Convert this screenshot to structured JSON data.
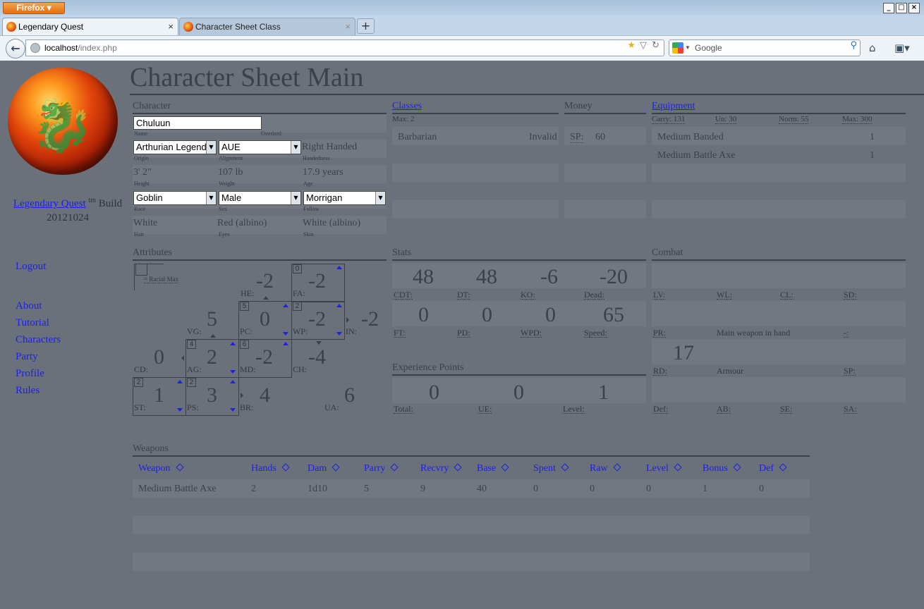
{
  "browser": {
    "menu_button": "Firefox ▾",
    "tabs": [
      {
        "title": "Legendary Quest",
        "close": "×"
      },
      {
        "title": "Character Sheet Class",
        "close": "×"
      }
    ],
    "new_tab": "+",
    "url_host": "localhost",
    "url_path": "/index.php",
    "search_placeholder": "Google",
    "window_min": "_",
    "window_max": "□",
    "window_close": "×"
  },
  "sidebar": {
    "brand_link": "Legendary Quest",
    "brand_sup": "tm",
    "build_label": "Build",
    "build_number": "20121024",
    "logout": "Logout",
    "nav": [
      "About",
      "Tutorial",
      "Characters",
      "Party",
      "Profile",
      "Rules"
    ]
  },
  "page": {
    "title": "Character Sheet Main"
  },
  "character": {
    "section": "Character",
    "name_value": "Chuluun",
    "name_label": "Name",
    "overlord_label": "Overlord",
    "origin_value": "Arthurian Legend",
    "origin_label": "Origin",
    "alignment_value": "AUE",
    "alignment_label": "Alignment",
    "handedness_value": "Right Handed",
    "handedness_label": "Handedness",
    "height_value": "3' 2\"",
    "height_label": "Height",
    "weight_value": "107 lb",
    "weight_label": "Weight",
    "age_value": "17.9 years",
    "age_label": "Age",
    "race_value": "Goblin",
    "race_label": "Race",
    "sex_value": "Male",
    "sex_label": "Sex",
    "follow_value": "Morrigan",
    "follow_label": "Follow",
    "hair_value": "White",
    "hair_label": "Hair",
    "eyes_value": "Red (albino)",
    "eyes_label": "Eyes",
    "skin_value": "White (albino)",
    "skin_label": "Skin"
  },
  "classes": {
    "section": "Classes",
    "max": "Max: 2",
    "items": [
      {
        "name": "Barbarian",
        "status": "Invalid"
      }
    ]
  },
  "money": {
    "section": "Money",
    "sp_label": "SP:",
    "sp_value": "60"
  },
  "equipment": {
    "section": "Equipment",
    "carry": "Carry: 131",
    "un": "Un: 30",
    "norm": "Norm: 55",
    "max": "Max: 300",
    "items": [
      {
        "name": "Medium Banded",
        "qty": "1"
      },
      {
        "name": "Medium Battle Axe",
        "qty": "1"
      }
    ]
  },
  "attributes": {
    "section": "Attributes",
    "racial_max": "= Racial Max",
    "he": {
      "label": "HE:",
      "value": "-2"
    },
    "fa": {
      "label": "FA:",
      "value": "-2",
      "box": "0"
    },
    "vg": {
      "label": "VG:",
      "value": "5"
    },
    "pc": {
      "label": "PC:",
      "value": "0",
      "box": "5"
    },
    "wp": {
      "label": "WP:",
      "value": "-2",
      "box": "2"
    },
    "in": {
      "label": "IN:",
      "value": "-2"
    },
    "cd": {
      "label": "CD:",
      "value": "0"
    },
    "ag": {
      "label": "AG:",
      "value": "2",
      "box": "4"
    },
    "md": {
      "label": "MD:",
      "value": "-2",
      "box": "6"
    },
    "ch": {
      "label": "CH:",
      "value": "-4"
    },
    "st": {
      "label": "ST:",
      "value": "1",
      "box": "2"
    },
    "ps": {
      "label": "PS:",
      "value": "3",
      "box": "2"
    },
    "br": {
      "label": "BR:",
      "value": "4"
    },
    "ua": {
      "label": "UA:",
      "value": "6"
    }
  },
  "stats": {
    "section": "Stats",
    "row1": [
      {
        "label": "CDT:",
        "value": "48"
      },
      {
        "label": "DT:",
        "value": "48"
      },
      {
        "label": "KO:",
        "value": "-6"
      },
      {
        "label": "Dead:",
        "value": "-20"
      }
    ],
    "row2": [
      {
        "label": "FT:",
        "value": "0"
      },
      {
        "label": "PD:",
        "value": "0"
      },
      {
        "label": "WPD:",
        "value": "0"
      },
      {
        "label": "Speed:",
        "value": "65"
      }
    ]
  },
  "xp": {
    "section": "Experience Points",
    "items": [
      {
        "label": "Total:",
        "value": "0"
      },
      {
        "label": "UE:",
        "value": "0"
      },
      {
        "label": "Level:",
        "value": "1"
      }
    ]
  },
  "combat": {
    "section": "Combat",
    "row1": [
      "LV:",
      "WL:",
      "CL:",
      "SD:"
    ],
    "pr": "PR:",
    "main_weapon": "Main weapon in hand",
    "dash": "-:",
    "rd_value": "17",
    "rd": "RD:",
    "armour": "Armour",
    "sp": "SP:",
    "row4": [
      "Def:",
      "AB:",
      "SE:",
      "SA:"
    ]
  },
  "weapons": {
    "section": "Weapons",
    "columns": [
      "Weapon",
      "Hands",
      "Dam",
      "Parry",
      "Recvry",
      "Base",
      "Spent",
      "Raw",
      "Level",
      "Bonus",
      "Def"
    ],
    "rows": [
      [
        "Medium Battle Axe",
        "2",
        "1d10",
        "5",
        "9",
        "40",
        "0",
        "0",
        "0",
        "1",
        "0"
      ]
    ]
  }
}
